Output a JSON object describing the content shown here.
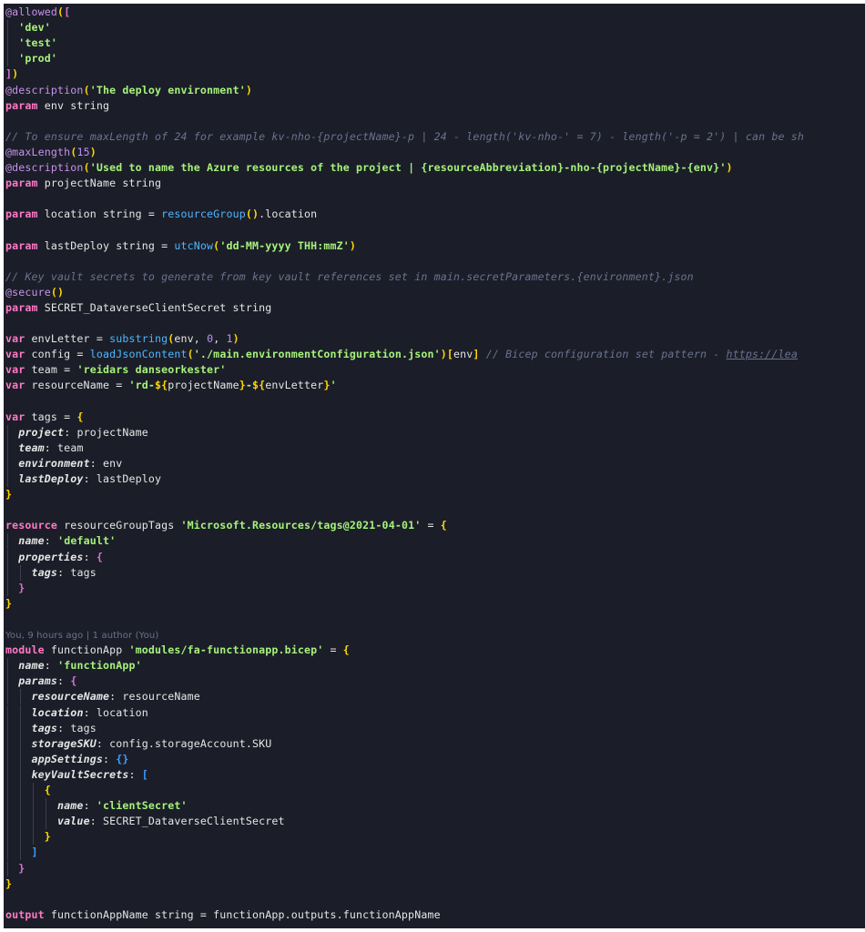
{
  "editor": {
    "lines": [
      {
        "tokens": [
          {
            "c": "dec",
            "t": "@allowed"
          },
          {
            "c": "b1",
            "t": "("
          },
          {
            "c": "b2",
            "t": "["
          }
        ]
      },
      {
        "tokens": [
          {
            "c": "t",
            "t": "  "
          },
          {
            "c": "str",
            "t": "'dev'"
          }
        ]
      },
      {
        "tokens": [
          {
            "c": "t",
            "t": "  "
          },
          {
            "c": "str",
            "t": "'test'"
          }
        ]
      },
      {
        "tokens": [
          {
            "c": "t",
            "t": "  "
          },
          {
            "c": "str",
            "t": "'prod'"
          }
        ]
      },
      {
        "tokens": [
          {
            "c": "b2",
            "t": "]"
          },
          {
            "c": "b1",
            "t": ")"
          }
        ]
      },
      {
        "tokens": [
          {
            "c": "dec",
            "t": "@description"
          },
          {
            "c": "b1",
            "t": "("
          },
          {
            "c": "str",
            "t": "'The deploy environment'"
          },
          {
            "c": "b1",
            "t": ")"
          }
        ]
      },
      {
        "tokens": [
          {
            "c": "kw",
            "t": "param"
          },
          {
            "c": "t",
            "t": " env string"
          }
        ]
      },
      {
        "tokens": []
      },
      {
        "tokens": [
          {
            "c": "cmt",
            "t": "// To ensure maxLength of 24 for example kv-nho-{projectName}-p | 24 - length('kv-nho-' = 7) - length('-p = 2') | can be sh"
          }
        ]
      },
      {
        "tokens": [
          {
            "c": "dec",
            "t": "@maxLength"
          },
          {
            "c": "b1",
            "t": "("
          },
          {
            "c": "num",
            "t": "15"
          },
          {
            "c": "b1",
            "t": ")"
          }
        ]
      },
      {
        "tokens": [
          {
            "c": "dec",
            "t": "@description"
          },
          {
            "c": "b1",
            "t": "("
          },
          {
            "c": "str",
            "t": "'Used to name the Azure resources of the project | {resourceAbbreviation}-nho-{projectName}-{env}'"
          },
          {
            "c": "b1",
            "t": ")"
          }
        ]
      },
      {
        "tokens": [
          {
            "c": "kw",
            "t": "param"
          },
          {
            "c": "t",
            "t": " projectName string"
          }
        ]
      },
      {
        "tokens": []
      },
      {
        "tokens": [
          {
            "c": "kw",
            "t": "param"
          },
          {
            "c": "t",
            "t": " location string = "
          },
          {
            "c": "fn",
            "t": "resourceGroup"
          },
          {
            "c": "b1",
            "t": "()"
          },
          {
            "c": "t",
            "t": ".location"
          }
        ]
      },
      {
        "tokens": []
      },
      {
        "tokens": [
          {
            "c": "kw",
            "t": "param"
          },
          {
            "c": "t",
            "t": " lastDeploy string = "
          },
          {
            "c": "fn",
            "t": "utcNow"
          },
          {
            "c": "b1",
            "t": "("
          },
          {
            "c": "str",
            "t": "'dd-MM-yyyy THH:mmZ'"
          },
          {
            "c": "b1",
            "t": ")"
          }
        ]
      },
      {
        "tokens": []
      },
      {
        "tokens": [
          {
            "c": "cmt",
            "t": "// Key vault secrets to generate from key vault references set in main.secretParameters.{environment}.json"
          }
        ]
      },
      {
        "tokens": [
          {
            "c": "dec",
            "t": "@secure"
          },
          {
            "c": "b1",
            "t": "()"
          }
        ]
      },
      {
        "tokens": [
          {
            "c": "kw",
            "t": "param"
          },
          {
            "c": "t",
            "t": " SECRET_DataverseClientSecret string"
          }
        ]
      },
      {
        "tokens": []
      },
      {
        "tokens": [
          {
            "c": "kw",
            "t": "var"
          },
          {
            "c": "t",
            "t": " envLetter = "
          },
          {
            "c": "fn",
            "t": "substring"
          },
          {
            "c": "b1",
            "t": "("
          },
          {
            "c": "t",
            "t": "env, "
          },
          {
            "c": "num",
            "t": "0"
          },
          {
            "c": "t",
            "t": ", "
          },
          {
            "c": "num",
            "t": "1"
          },
          {
            "c": "b1",
            "t": ")"
          }
        ]
      },
      {
        "tokens": [
          {
            "c": "kw",
            "t": "var"
          },
          {
            "c": "t",
            "t": " config = "
          },
          {
            "c": "fn",
            "t": "loadJsonContent"
          },
          {
            "c": "b1",
            "t": "("
          },
          {
            "c": "str",
            "t": "'./main.environmentConfiguration.json'"
          },
          {
            "c": "b1",
            "t": ")"
          },
          {
            "c": "b1",
            "t": "["
          },
          {
            "c": "t",
            "t": "env"
          },
          {
            "c": "b1",
            "t": "]"
          },
          {
            "c": "t",
            "t": " "
          },
          {
            "c": "cmt",
            "t": "// Bicep configuration set pattern - "
          },
          {
            "c": "link",
            "t": "https://lea"
          }
        ]
      },
      {
        "tokens": [
          {
            "c": "kw",
            "t": "var"
          },
          {
            "c": "t",
            "t": " team = "
          },
          {
            "c": "str",
            "t": "'reidars danseorkester'"
          }
        ]
      },
      {
        "tokens": [
          {
            "c": "kw",
            "t": "var"
          },
          {
            "c": "t",
            "t": " resourceName = "
          },
          {
            "c": "str",
            "t": "'rd-"
          },
          {
            "c": "b1",
            "t": "${"
          },
          {
            "c": "t",
            "t": "projectName"
          },
          {
            "c": "b1",
            "t": "}"
          },
          {
            "c": "str",
            "t": "-"
          },
          {
            "c": "b1",
            "t": "${"
          },
          {
            "c": "t",
            "t": "envLetter"
          },
          {
            "c": "b1",
            "t": "}"
          },
          {
            "c": "str",
            "t": "'"
          }
        ]
      },
      {
        "tokens": []
      },
      {
        "tokens": [
          {
            "c": "kw",
            "t": "var"
          },
          {
            "c": "t",
            "t": " tags = "
          },
          {
            "c": "b1",
            "t": "{"
          }
        ]
      },
      {
        "tokens": [
          {
            "c": "t",
            "t": "  "
          },
          {
            "c": "prop",
            "t": "project"
          },
          {
            "c": "t",
            "t": ": projectName"
          }
        ]
      },
      {
        "tokens": [
          {
            "c": "t",
            "t": "  "
          },
          {
            "c": "prop",
            "t": "team"
          },
          {
            "c": "t",
            "t": ": team"
          }
        ]
      },
      {
        "tokens": [
          {
            "c": "t",
            "t": "  "
          },
          {
            "c": "prop",
            "t": "environment"
          },
          {
            "c": "t",
            "t": ": env"
          }
        ]
      },
      {
        "tokens": [
          {
            "c": "t",
            "t": "  "
          },
          {
            "c": "prop",
            "t": "lastDeploy"
          },
          {
            "c": "t",
            "t": ": lastDeploy"
          }
        ]
      },
      {
        "tokens": [
          {
            "c": "b1",
            "t": "}"
          }
        ]
      },
      {
        "tokens": []
      },
      {
        "tokens": [
          {
            "c": "kw",
            "t": "resource"
          },
          {
            "c": "t",
            "t": " resourceGroupTags "
          },
          {
            "c": "str",
            "t": "'Microsoft.Resources/tags@2021-04-01'"
          },
          {
            "c": "t",
            "t": " = "
          },
          {
            "c": "b1",
            "t": "{"
          }
        ]
      },
      {
        "tokens": [
          {
            "c": "t",
            "t": "  "
          },
          {
            "c": "prop",
            "t": "name"
          },
          {
            "c": "t",
            "t": ": "
          },
          {
            "c": "str",
            "t": "'default'"
          }
        ]
      },
      {
        "tokens": [
          {
            "c": "t",
            "t": "  "
          },
          {
            "c": "prop",
            "t": "properties"
          },
          {
            "c": "t",
            "t": ": "
          },
          {
            "c": "b2",
            "t": "{"
          }
        ]
      },
      {
        "tokens": [
          {
            "c": "t",
            "t": "    "
          },
          {
            "c": "prop",
            "t": "tags"
          },
          {
            "c": "t",
            "t": ": tags"
          }
        ]
      },
      {
        "tokens": [
          {
            "c": "t",
            "t": "  "
          },
          {
            "c": "b2",
            "t": "}"
          }
        ]
      },
      {
        "tokens": [
          {
            "c": "b1",
            "t": "}"
          }
        ]
      },
      {
        "tokens": []
      },
      {
        "tokens": [
          {
            "c": "blame",
            "t": "You, 9 hours ago | 1 author (You)"
          }
        ]
      },
      {
        "tokens": [
          {
            "c": "kw",
            "t": "module"
          },
          {
            "c": "t",
            "t": " functionApp "
          },
          {
            "c": "str",
            "t": "'modules/fa-functionapp.bicep'"
          },
          {
            "c": "t",
            "t": " = "
          },
          {
            "c": "b1",
            "t": "{"
          }
        ]
      },
      {
        "tokens": [
          {
            "c": "t",
            "t": "  "
          },
          {
            "c": "prop",
            "t": "name"
          },
          {
            "c": "t",
            "t": ": "
          },
          {
            "c": "str",
            "t": "'functionApp'"
          }
        ]
      },
      {
        "tokens": [
          {
            "c": "t",
            "t": "  "
          },
          {
            "c": "prop",
            "t": "params"
          },
          {
            "c": "t",
            "t": ": "
          },
          {
            "c": "b2",
            "t": "{"
          }
        ]
      },
      {
        "tokens": [
          {
            "c": "t",
            "t": "    "
          },
          {
            "c": "prop",
            "t": "resourceName"
          },
          {
            "c": "t",
            "t": ": resourceName"
          }
        ]
      },
      {
        "tokens": [
          {
            "c": "t",
            "t": "    "
          },
          {
            "c": "prop",
            "t": "location"
          },
          {
            "c": "t",
            "t": ": location"
          }
        ]
      },
      {
        "tokens": [
          {
            "c": "t",
            "t": "    "
          },
          {
            "c": "prop",
            "t": "tags"
          },
          {
            "c": "t",
            "t": ": tags"
          }
        ]
      },
      {
        "tokens": [
          {
            "c": "t",
            "t": "    "
          },
          {
            "c": "prop",
            "t": "storageSKU"
          },
          {
            "c": "t",
            "t": ": config.storageAccount.SKU"
          }
        ]
      },
      {
        "tokens": [
          {
            "c": "t",
            "t": "    "
          },
          {
            "c": "prop",
            "t": "appSettings"
          },
          {
            "c": "t",
            "t": ": "
          },
          {
            "c": "b3",
            "t": "{}"
          }
        ]
      },
      {
        "tokens": [
          {
            "c": "t",
            "t": "    "
          },
          {
            "c": "prop",
            "t": "keyVaultSecrets"
          },
          {
            "c": "t",
            "t": ": "
          },
          {
            "c": "b3",
            "t": "["
          }
        ]
      },
      {
        "tokens": [
          {
            "c": "t",
            "t": "      "
          },
          {
            "c": "b1",
            "t": "{"
          }
        ]
      },
      {
        "tokens": [
          {
            "c": "t",
            "t": "        "
          },
          {
            "c": "prop",
            "t": "name"
          },
          {
            "c": "t",
            "t": ": "
          },
          {
            "c": "str",
            "t": "'clientSecret'"
          }
        ]
      },
      {
        "tokens": [
          {
            "c": "t",
            "t": "        "
          },
          {
            "c": "prop",
            "t": "value"
          },
          {
            "c": "t",
            "t": ": SECRET_DataverseClientSecret"
          }
        ]
      },
      {
        "tokens": [
          {
            "c": "t",
            "t": "      "
          },
          {
            "c": "b1",
            "t": "}"
          }
        ]
      },
      {
        "tokens": [
          {
            "c": "t",
            "t": "    "
          },
          {
            "c": "b3",
            "t": "]"
          }
        ]
      },
      {
        "tokens": [
          {
            "c": "t",
            "t": "  "
          },
          {
            "c": "b2",
            "t": "}"
          }
        ]
      },
      {
        "tokens": [
          {
            "c": "b1",
            "t": "}"
          }
        ]
      },
      {
        "tokens": []
      },
      {
        "tokens": [
          {
            "c": "kw",
            "t": "output"
          },
          {
            "c": "t",
            "t": " functionAppName string = functionApp.outputs.functionAppName"
          }
        ]
      }
    ]
  }
}
